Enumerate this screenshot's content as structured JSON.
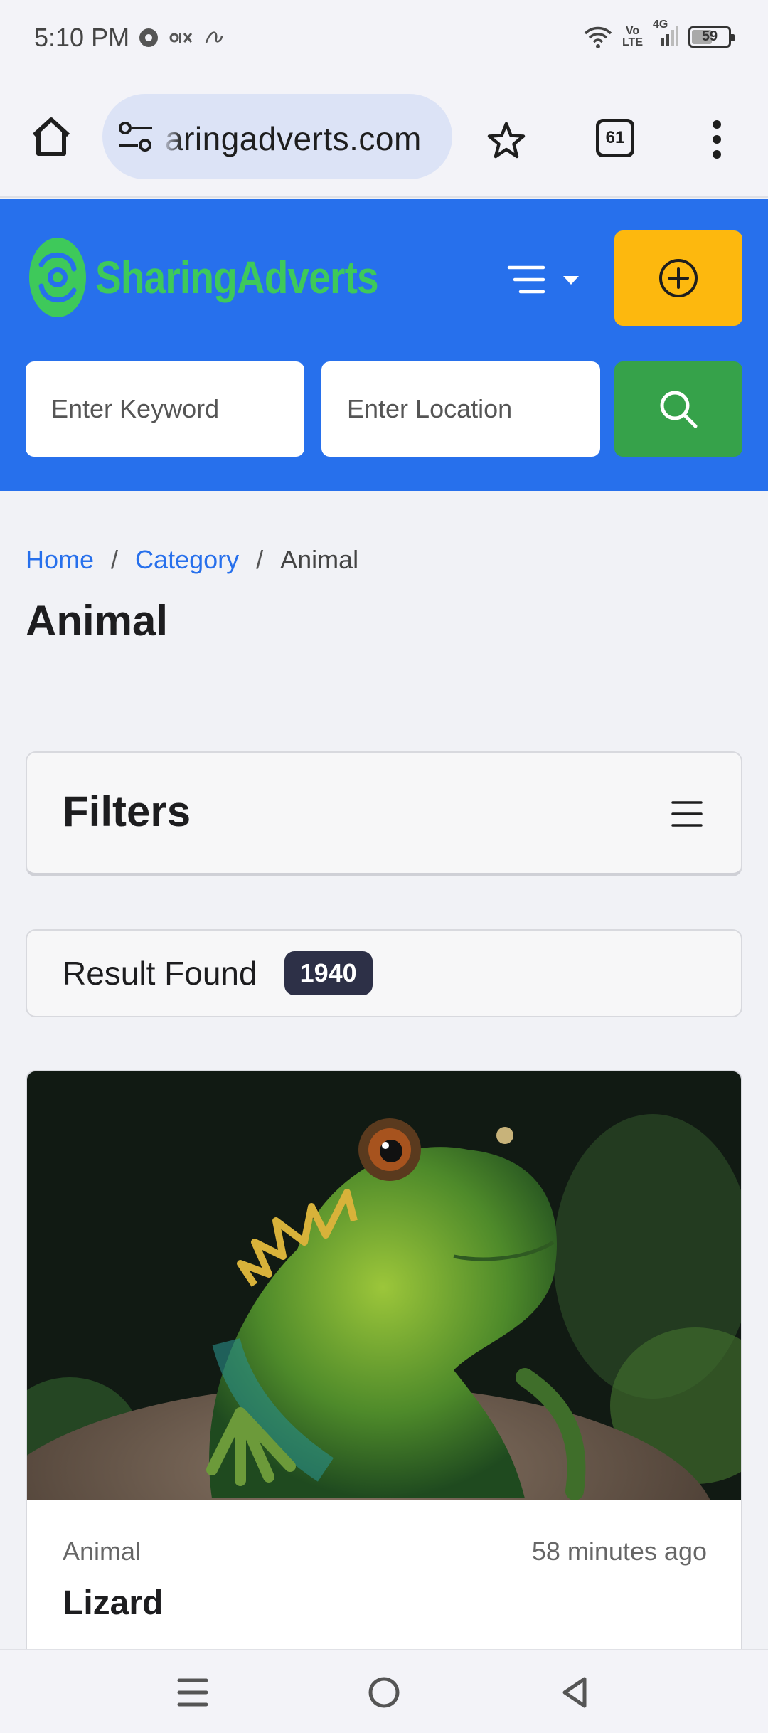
{
  "status_bar": {
    "time": "5:10 PM",
    "network_top": "Vo",
    "network_bottom": "LTE",
    "cell": "4G",
    "battery": "59",
    "battery_level": 0.59
  },
  "browser": {
    "url": "aringadverts.com",
    "tab_count": "61"
  },
  "site": {
    "logo_text": "SharingAdverts",
    "brand_color": "#2770ec",
    "logo_color": "#3ec95a",
    "post_button_color": "#fdb80e",
    "search_button_color": "#36a24a"
  },
  "search": {
    "keyword_placeholder": "Enter Keyword",
    "location_placeholder": "Enter Location"
  },
  "breadcrumb": {
    "home": "Home",
    "sep": "/",
    "category": "Category",
    "current": "Animal"
  },
  "page_title": "Animal",
  "filters": {
    "title": "Filters"
  },
  "results": {
    "label": "Result Found",
    "count": "1940"
  },
  "listing": {
    "category": "Animal",
    "time": "58 minutes ago",
    "title": "Lizard",
    "image_subject": "green lizard on a rock"
  },
  "icons": {
    "home": "home-icon",
    "tune": "site-settings-icon",
    "bookmark": "star-icon",
    "tabs": "tabs-icon",
    "overflow": "more-vert-icon",
    "menu": "hamburger-dropdown-icon",
    "post": "plus-circle-icon",
    "search": "search-icon",
    "filters": "filter-menu-icon"
  }
}
